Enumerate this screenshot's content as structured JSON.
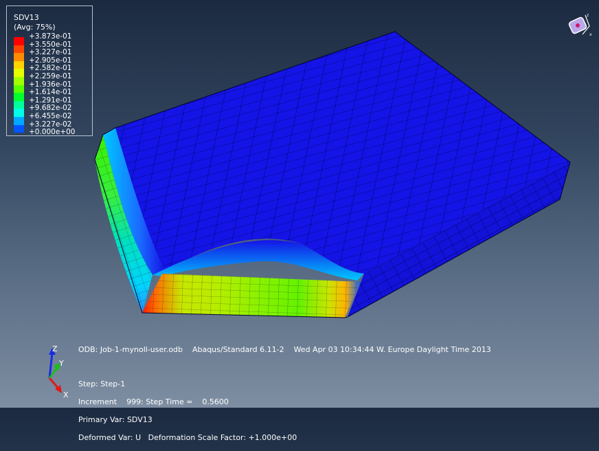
{
  "legend": {
    "title": "SDV13",
    "subtitle": "(Avg: 75%)",
    "levels": [
      {
        "label": "+3.873e-01",
        "color": "#ff0000"
      },
      {
        "label": "+3.550e-01",
        "color": "#ff4600"
      },
      {
        "label": "+3.227e-01",
        "color": "#ff8c00"
      },
      {
        "label": "+2.905e-01",
        "color": "#ffd200"
      },
      {
        "label": "+2.582e-01",
        "color": "#e6ff00"
      },
      {
        "label": "+2.259e-01",
        "color": "#a0ff00"
      },
      {
        "label": "+1.936e-01",
        "color": "#5aff00"
      },
      {
        "label": "+1.614e-01",
        "color": "#00ff2c"
      },
      {
        "label": "+1.291e-01",
        "color": "#00ff9b"
      },
      {
        "label": "+9.682e-02",
        "color": "#00ffe6"
      },
      {
        "label": "+6.455e-02",
        "color": "#00a8ff"
      },
      {
        "label": "+3.227e-02",
        "color": "#0055ff"
      },
      {
        "label": "+0.000e+00",
        "color": "#0000ff"
      }
    ]
  },
  "info": {
    "odb_line": "ODB: Job-1-mynoll-user.odb    Abaqus/Standard 6.11-2    Wed Apr 03 10:34:44 W. Europe Daylight Time 2013",
    "step": "Step: Step-1",
    "increment": "Increment    999: Step Time =    0.5600",
    "primary_var": "Primary Var: SDV13",
    "deformed_var": "Deformed Var: U   Deformation Scale Factor: +1.000e+00"
  },
  "triad": {
    "x": "X",
    "y": "Y",
    "z": "Z"
  },
  "colors": {
    "mesh_blue": "#1414e6",
    "mesh_line": "#000050"
  }
}
